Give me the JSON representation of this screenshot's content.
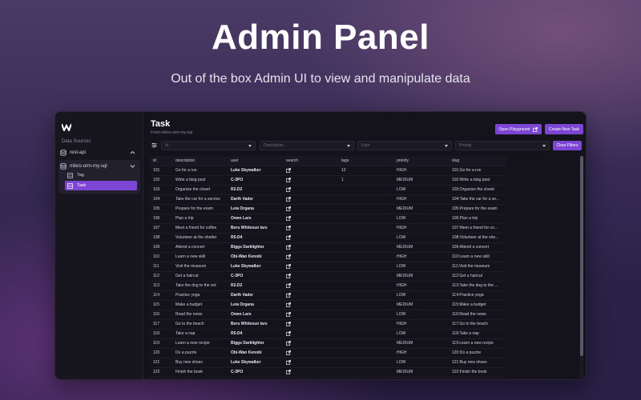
{
  "hero": {
    "title": "Admin Panel",
    "subtitle": "Out of the box Admin UI to view and manipulate data"
  },
  "sidebar": {
    "sources_label": "Data Sources",
    "sources": [
      {
        "name": "rest-api",
        "expanded": false
      },
      {
        "name": "mikro-orm-my-sql",
        "expanded": true,
        "entities": [
          "Tag",
          "Task"
        ]
      }
    ],
    "selected_entity": "Task"
  },
  "page": {
    "title": "Task",
    "source": "From mikro-orm-my-sql",
    "open_playground_label": "Open Playground",
    "create_label": "Create New Task",
    "clear_filters_label": "Clear Filters"
  },
  "filters": {
    "id_placeholder": "Id",
    "description_placeholder": "Description",
    "user_placeholder": "User",
    "priority_placeholder": "Priority"
  },
  "table": {
    "columns": [
      "id",
      "description",
      "user",
      "search",
      "tags",
      "priority",
      "slug"
    ],
    "rows": [
      {
        "id": "101",
        "description": "Go for a run",
        "user": "Luke Skywalker",
        "tags": "12",
        "priority": "HIGH",
        "slug": "101:Go for a run"
      },
      {
        "id": "102",
        "description": "Write a blog post",
        "user": "C-3PO",
        "tags": "1",
        "priority": "MEDIUM",
        "slug": "102:Write a blog post"
      },
      {
        "id": "103",
        "description": "Organize the closet",
        "user": "R2-D2",
        "tags": "",
        "priority": "LOW",
        "slug": "103:Organize the closet"
      },
      {
        "id": "104",
        "description": "Take the car for a service",
        "user": "Darth Vader",
        "tags": "",
        "priority": "HIGH",
        "slug": "104:Take the car for a se..."
      },
      {
        "id": "105",
        "description": "Prepare for the exam",
        "user": "Leia Organa",
        "tags": "",
        "priority": "MEDIUM",
        "slug": "105:Prepare for the exam"
      },
      {
        "id": "106",
        "description": "Plan a trip",
        "user": "Owen Lars",
        "tags": "",
        "priority": "LOW",
        "slug": "106:Plan a trip"
      },
      {
        "id": "107",
        "description": "Meet a friend for coffee",
        "user": "Beru Whitesun lars",
        "tags": "",
        "priority": "HIGH",
        "slug": "107:Meet a friend for co..."
      },
      {
        "id": "108",
        "description": "Volunteer at the shelter",
        "user": "R5-D4",
        "tags": "",
        "priority": "LOW",
        "slug": "108:Volunteer at the she..."
      },
      {
        "id": "109",
        "description": "Attend a concert",
        "user": "Biggs Darklighter",
        "tags": "",
        "priority": "MEDIUM",
        "slug": "109:Attend a concert"
      },
      {
        "id": "110",
        "description": "Learn a new skill",
        "user": "Obi-Wan Kenobi",
        "tags": "",
        "priority": "HIGH",
        "slug": "110:Learn a new skill"
      },
      {
        "id": "111",
        "description": "Visit the museum",
        "user": "Luke Skywalker",
        "tags": "",
        "priority": "LOW",
        "slug": "111:Visit the museum"
      },
      {
        "id": "112",
        "description": "Get a haircut",
        "user": "C-3PO",
        "tags": "",
        "priority": "MEDIUM",
        "slug": "112:Get a haircut"
      },
      {
        "id": "113",
        "description": "Take the dog to the vet",
        "user": "R2-D2",
        "tags": "",
        "priority": "HIGH",
        "slug": "113:Take the dog to the ..."
      },
      {
        "id": "114",
        "description": "Practice yoga",
        "user": "Darth Vader",
        "tags": "",
        "priority": "LOW",
        "slug": "114:Practice yoga"
      },
      {
        "id": "115",
        "description": "Make a budget",
        "user": "Leia Organa",
        "tags": "",
        "priority": "MEDIUM",
        "slug": "115:Make a budget"
      },
      {
        "id": "116",
        "description": "Read the news",
        "user": "Owen Lars",
        "tags": "",
        "priority": "LOW",
        "slug": "116:Read the news"
      },
      {
        "id": "117",
        "description": "Go to the beach",
        "user": "Beru Whitesun lars",
        "tags": "",
        "priority": "HIGH",
        "slug": "117:Go to the beach"
      },
      {
        "id": "118",
        "description": "Take a nap",
        "user": "R5-D4",
        "tags": "",
        "priority": "LOW",
        "slug": "118:Take a nap"
      },
      {
        "id": "119",
        "description": "Learn a new recipe",
        "user": "Biggs Darklighter",
        "tags": "",
        "priority": "MEDIUM",
        "slug": "119:Learn a new recipe"
      },
      {
        "id": "120",
        "description": "Do a puzzle",
        "user": "Obi-Wan Kenobi",
        "tags": "",
        "priority": "HIGH",
        "slug": "120:Do a puzzle"
      },
      {
        "id": "121",
        "description": "Buy new shoes",
        "user": "Luke Skywalker",
        "tags": "",
        "priority": "LOW",
        "slug": "121:Buy new shoes"
      },
      {
        "id": "122",
        "description": "Finish the book",
        "user": "C-3PO",
        "tags": "",
        "priority": "MEDIUM",
        "slug": "122:Finish the book"
      }
    ]
  },
  "icons": {
    "logo": "logo-icon",
    "database": "database-icon",
    "table": "table-icon",
    "external_link": "external-link-icon",
    "filter": "filter-icon",
    "chevron": "chevron-up-icon"
  },
  "colors": {
    "accent": "#7c45d4",
    "window_bg": "#14121b",
    "sidebar_bg": "#17151e"
  }
}
